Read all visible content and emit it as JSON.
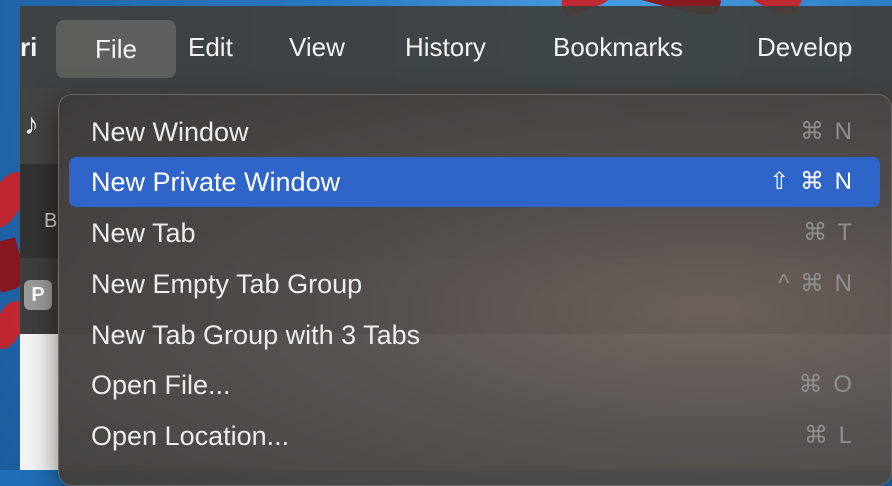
{
  "menubar": {
    "app_partial": "ri",
    "items": [
      {
        "label": "File"
      },
      {
        "label": "Edit"
      },
      {
        "label": "View"
      },
      {
        "label": "History"
      },
      {
        "label": "Bookmarks"
      },
      {
        "label": "Develop"
      }
    ]
  },
  "safari": {
    "toolbar_icon": "music-note-icon",
    "toolbar_icon_glyph": "♪",
    "partial_label": "B",
    "profile_badge": "P"
  },
  "file_menu": {
    "items": [
      {
        "label": "New Window",
        "shortcut": "⌘ N",
        "highlighted": false
      },
      {
        "label": "New Private Window",
        "shortcut": "⇧ ⌘ N",
        "highlighted": true
      },
      {
        "label": "New Tab",
        "shortcut": "⌘ T",
        "highlighted": false
      },
      {
        "label": "New Empty Tab Group",
        "shortcut": "^ ⌘ N",
        "highlighted": false
      },
      {
        "label": "New Tab Group with 3 Tabs",
        "shortcut": "",
        "highlighted": false
      },
      {
        "label": "Open File...",
        "shortcut": "⌘ O",
        "highlighted": false
      },
      {
        "label": "Open Location...",
        "shortcut": "⌘ L",
        "highlighted": false
      }
    ]
  },
  "colors": {
    "menu_highlight": "#2f64c9",
    "menubar_bg": "#40403c",
    "wallpaper_sky": "#2a78c2",
    "wallpaper_leaves": "#c8242a"
  }
}
